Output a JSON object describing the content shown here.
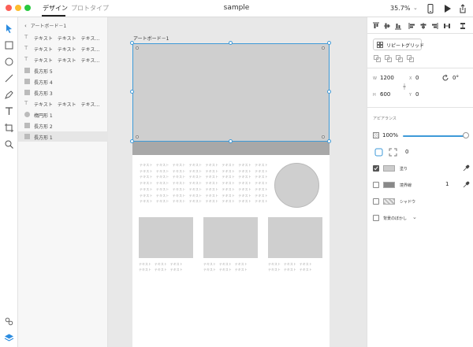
{
  "titlebar": {
    "tabs": [
      "デザイン",
      "プロトタイプ"
    ],
    "document_title": "sample",
    "zoom": "35.7%",
    "zoom_caret": "⌄"
  },
  "layers": {
    "header": "アートボード－1",
    "items": [
      {
        "label": "テキスト　テキスト　テキス…",
        "icon": "text-icon"
      },
      {
        "label": "テキスト　テキスト　テキス…",
        "icon": "text-icon"
      },
      {
        "label": "テキスト　テキスト　テキス…",
        "icon": "text-icon"
      },
      {
        "label": "長方形 5",
        "icon": "rectangle-icon"
      },
      {
        "label": "長方形 4",
        "icon": "rectangle-icon"
      },
      {
        "label": "長方形 3",
        "icon": "rectangle-icon"
      },
      {
        "label": "テキスト　テキスト　テキス…",
        "icon": "text-icon"
      },
      {
        "label": "楕円形 1",
        "icon": "ellipse-icon"
      },
      {
        "label": "長方形 2",
        "icon": "rectangle-icon"
      },
      {
        "label": "長方形 1",
        "icon": "rectangle-icon"
      }
    ]
  },
  "canvas": {
    "artboard_label": "アートボード－1",
    "text_lines": [
      "テキスト　テキスト　テキスト　テキスト　テキスト　テキスト　テキスト　テキスト",
      "テキスト　テキスト　テキスト　テキスト　テキスト　テキスト　テキスト　テキスト",
      "テキスト　テキスト　テキスト　テキスト　テキスト　テキスト　テキスト　テキスト",
      "テキスト　テキスト　テキスト　テキスト　テキスト　テキスト　テキスト　テキスト",
      "テキスト　テキスト　テキスト　テキスト　テキスト　テキスト　テキスト　テキスト",
      "テキスト　テキスト　テキスト　テキスト　テキスト　テキスト　テキスト　テキスト",
      "テキスト　テキスト　テキスト　テキスト　テキスト　テキスト　テキスト　テキスト"
    ],
    "card_text": [
      "テキスト　テキスト　テキスト",
      "テキスト　テキスト　テキスト"
    ]
  },
  "properties": {
    "repeat_grid_label": "リピートグリッド",
    "w_label": "W",
    "w_value": "1200",
    "h_label": "H",
    "h_value": "600",
    "x_label": "X",
    "x_value": "0",
    "y_label": "Y",
    "y_value": "0",
    "rotation": "0°",
    "appearance_title": "アピアランス",
    "opacity": "100%",
    "opacity_level": 1.0,
    "corner_radius": "0",
    "fill_label": "塗り",
    "fill_checked": true,
    "fill_color": "#cccccc",
    "stroke_label": "境界線",
    "stroke_checked": false,
    "stroke_color": "#888888",
    "stroke_width": "1",
    "shadow_label": "シャドウ",
    "shadow_checked": false,
    "blur_label": "背景のぼかし",
    "blur_checked": false,
    "blur_caret": "⌄"
  },
  "colors": {
    "accent": "#3e9ad8",
    "toolbar_icon": "#555555",
    "active_tool": "#2b8ce0"
  }
}
